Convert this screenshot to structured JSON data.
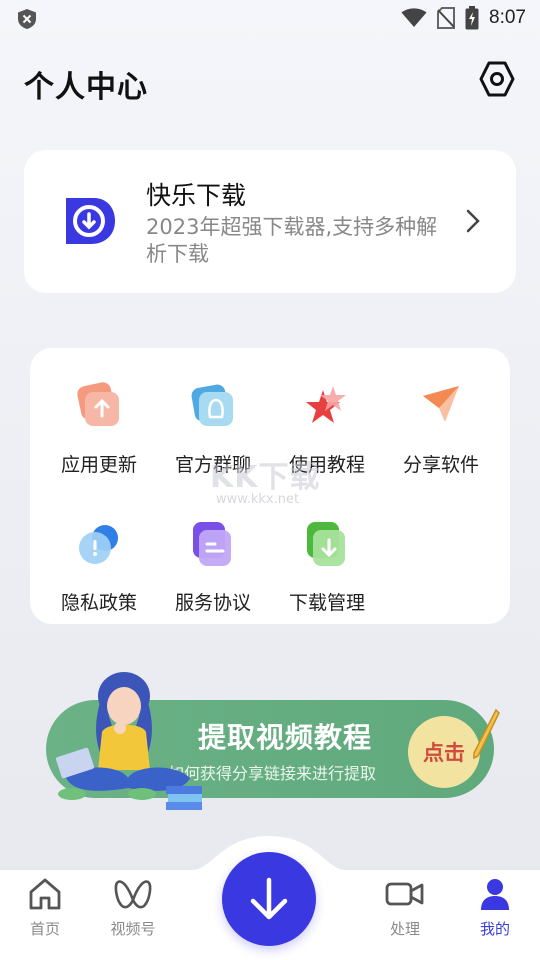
{
  "status_bar": {
    "time": "8:07"
  },
  "header": {
    "title": "个人中心"
  },
  "app_card": {
    "name": "快乐下载",
    "description": "2023年超强下载器,支持多种解析下载"
  },
  "grid": {
    "items": [
      {
        "label": "应用更新",
        "icon": "upload-icon",
        "color": "#f36e5a"
      },
      {
        "label": "官方群聊",
        "icon": "qq-icon",
        "color": "#4aaae0"
      },
      {
        "label": "使用教程",
        "icon": "star-icon",
        "color": "#f04f4f"
      },
      {
        "label": "分享软件",
        "icon": "paper-plane-icon",
        "color": "#f59256"
      },
      {
        "label": "隐私政策",
        "icon": "privacy-icon",
        "color": "#3b8ee6"
      },
      {
        "label": "服务协议",
        "icon": "document-icon",
        "color": "#8a5ef0"
      },
      {
        "label": "下载管理",
        "icon": "download-icon",
        "color": "#5cc04d"
      }
    ]
  },
  "watermark": {
    "big": "KK下载",
    "small": "www.kkx.net"
  },
  "banner": {
    "title": "提取视频教程",
    "subtitle": "如何获得分享链接来进行提取",
    "button": "点击"
  },
  "bottom_nav": {
    "items": [
      {
        "label": "首页",
        "icon": "home-icon"
      },
      {
        "label": "视频号",
        "icon": "butterfly-icon"
      },
      {
        "label": "处理",
        "icon": "video-camera-icon"
      },
      {
        "label": "我的",
        "icon": "person-icon",
        "active": true
      }
    ],
    "accent": "#3a38e0"
  }
}
